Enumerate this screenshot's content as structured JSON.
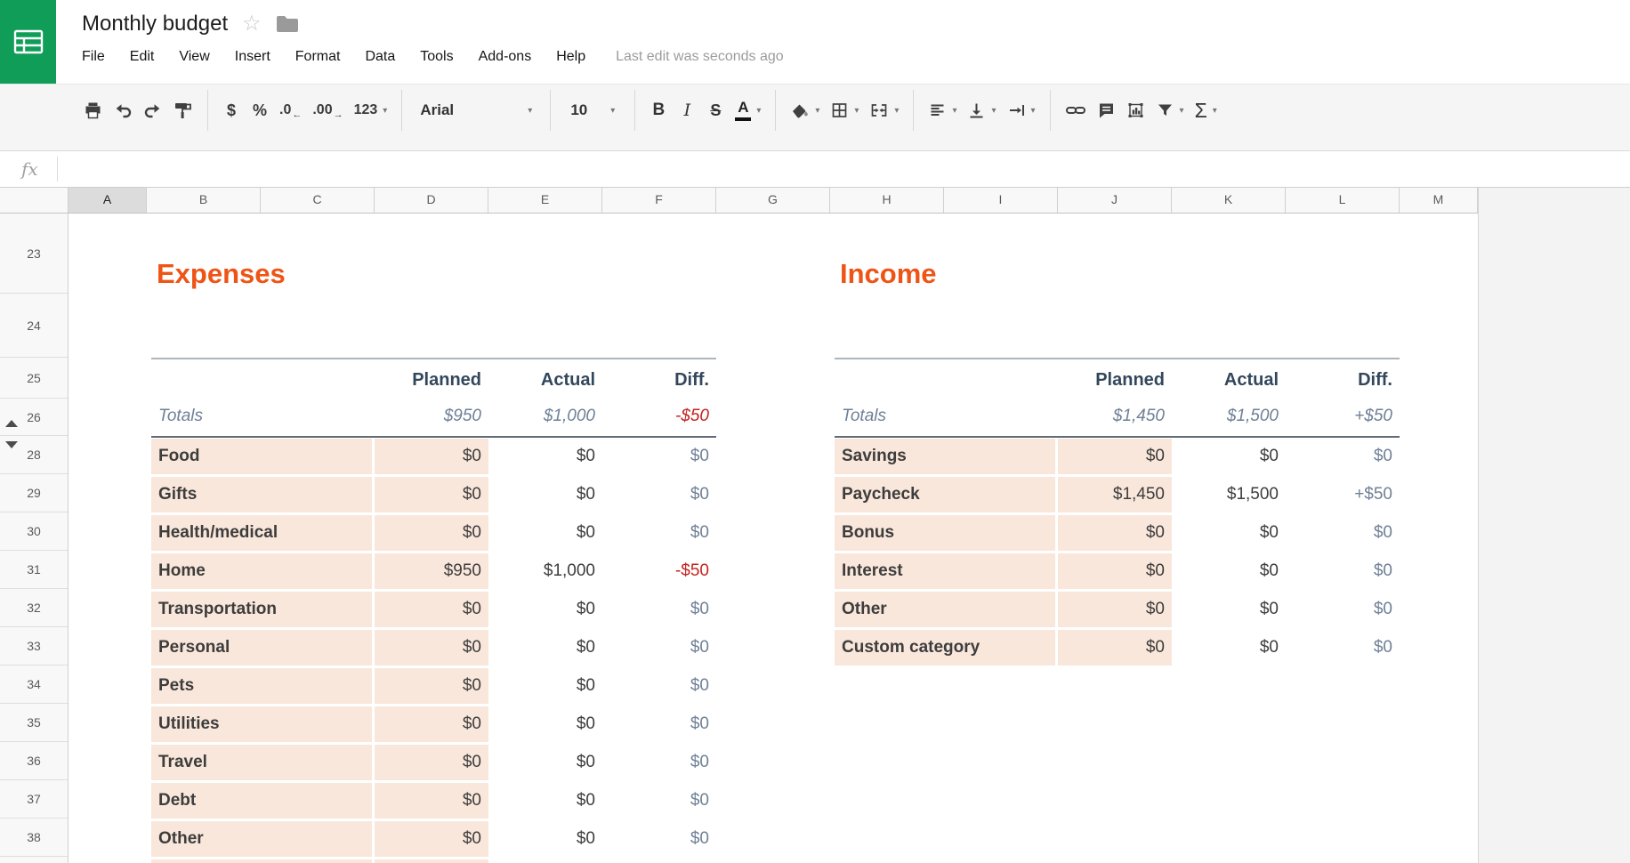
{
  "app": {
    "title": "Monthly budget",
    "menu": [
      "File",
      "Edit",
      "View",
      "Insert",
      "Format",
      "Data",
      "Tools",
      "Add-ons",
      "Help"
    ],
    "last_edit": "Last edit was seconds ago"
  },
  "toolbar": {
    "currency_label": "$",
    "percent_label": "%",
    "decimal_decrease_label": ".0",
    "decimal_increase_label": ".00",
    "more_formats_label": "123",
    "font_name": "Arial",
    "font_size": "10",
    "bold_label": "B",
    "italic_label": "I",
    "strikethrough_label": "S",
    "text_color_label": "A",
    "functions_label": "Σ",
    "icons": [
      "print",
      "undo",
      "redo",
      "paint-format",
      "currency-format",
      "percent-format",
      "decrease-decimal-places",
      "increase-decimal-places",
      "more-formats",
      "font-family",
      "font-size",
      "bold",
      "italic",
      "strikethrough",
      "text-color",
      "fill-color",
      "borders",
      "merge-cells",
      "horizontal-align",
      "vertical-align",
      "text-wrap",
      "insert-link",
      "insert-comment",
      "insert-chart",
      "filter",
      "functions"
    ]
  },
  "formula_bar": {
    "fx_label": "fx",
    "value": ""
  },
  "grid": {
    "columns": [
      "A",
      "B",
      "C",
      "D",
      "E",
      "F",
      "G",
      "H",
      "I",
      "J",
      "K",
      "L",
      "M"
    ],
    "selected_column": "A",
    "rows": [
      "23",
      "24",
      "25",
      "26",
      "28",
      "29",
      "30",
      "31",
      "32",
      "33",
      "34",
      "35",
      "36",
      "37",
      "38"
    ]
  },
  "expenses_table": {
    "title": "Expenses",
    "columns": [
      "Planned",
      "Actual",
      "Diff."
    ],
    "totals": {
      "label": "Totals",
      "planned": "$950",
      "actual": "$1,000",
      "diff": "-$50"
    },
    "rows": [
      {
        "category": "Food",
        "planned": "$0",
        "actual": "$0",
        "diff": "$0"
      },
      {
        "category": "Gifts",
        "planned": "$0",
        "actual": "$0",
        "diff": "$0"
      },
      {
        "category": "Health/medical",
        "planned": "$0",
        "actual": "$0",
        "diff": "$0"
      },
      {
        "category": "Home",
        "planned": "$950",
        "actual": "$1,000",
        "diff": "-$50"
      },
      {
        "category": "Transportation",
        "planned": "$0",
        "actual": "$0",
        "diff": "$0"
      },
      {
        "category": "Personal",
        "planned": "$0",
        "actual": "$0",
        "diff": "$0"
      },
      {
        "category": "Pets",
        "planned": "$0",
        "actual": "$0",
        "diff": "$0"
      },
      {
        "category": "Utilities",
        "planned": "$0",
        "actual": "$0",
        "diff": "$0"
      },
      {
        "category": "Travel",
        "planned": "$0",
        "actual": "$0",
        "diff": "$0"
      },
      {
        "category": "Debt",
        "planned": "$0",
        "actual": "$0",
        "diff": "$0"
      },
      {
        "category": "Other",
        "planned": "$0",
        "actual": "$0",
        "diff": "$0"
      }
    ]
  },
  "income_table": {
    "title": "Income",
    "columns": [
      "Planned",
      "Actual",
      "Diff."
    ],
    "totals": {
      "label": "Totals",
      "planned": "$1,450",
      "actual": "$1,500",
      "diff": "+$50"
    },
    "rows": [
      {
        "category": "Savings",
        "planned": "$0",
        "actual": "$0",
        "diff": "$0"
      },
      {
        "category": "Paycheck",
        "planned": "$1,450",
        "actual": "$1,500",
        "diff": "+$50"
      },
      {
        "category": "Bonus",
        "planned": "$0",
        "actual": "$0",
        "diff": "$0"
      },
      {
        "category": "Interest",
        "planned": "$0",
        "actual": "$0",
        "diff": "$0"
      },
      {
        "category": "Other",
        "planned": "$0",
        "actual": "$0",
        "diff": "$0"
      },
      {
        "category": "Custom category",
        "planned": "$0",
        "actual": "$0",
        "diff": "$0"
      }
    ]
  },
  "colors": {
    "accent_orange": "#EE5415",
    "header_navy": "#33475C",
    "muted_blue": "#6F8096",
    "negative_red": "#C5221F",
    "row_pink": "#FAE7DB",
    "logo_green": "#0F9D58"
  }
}
